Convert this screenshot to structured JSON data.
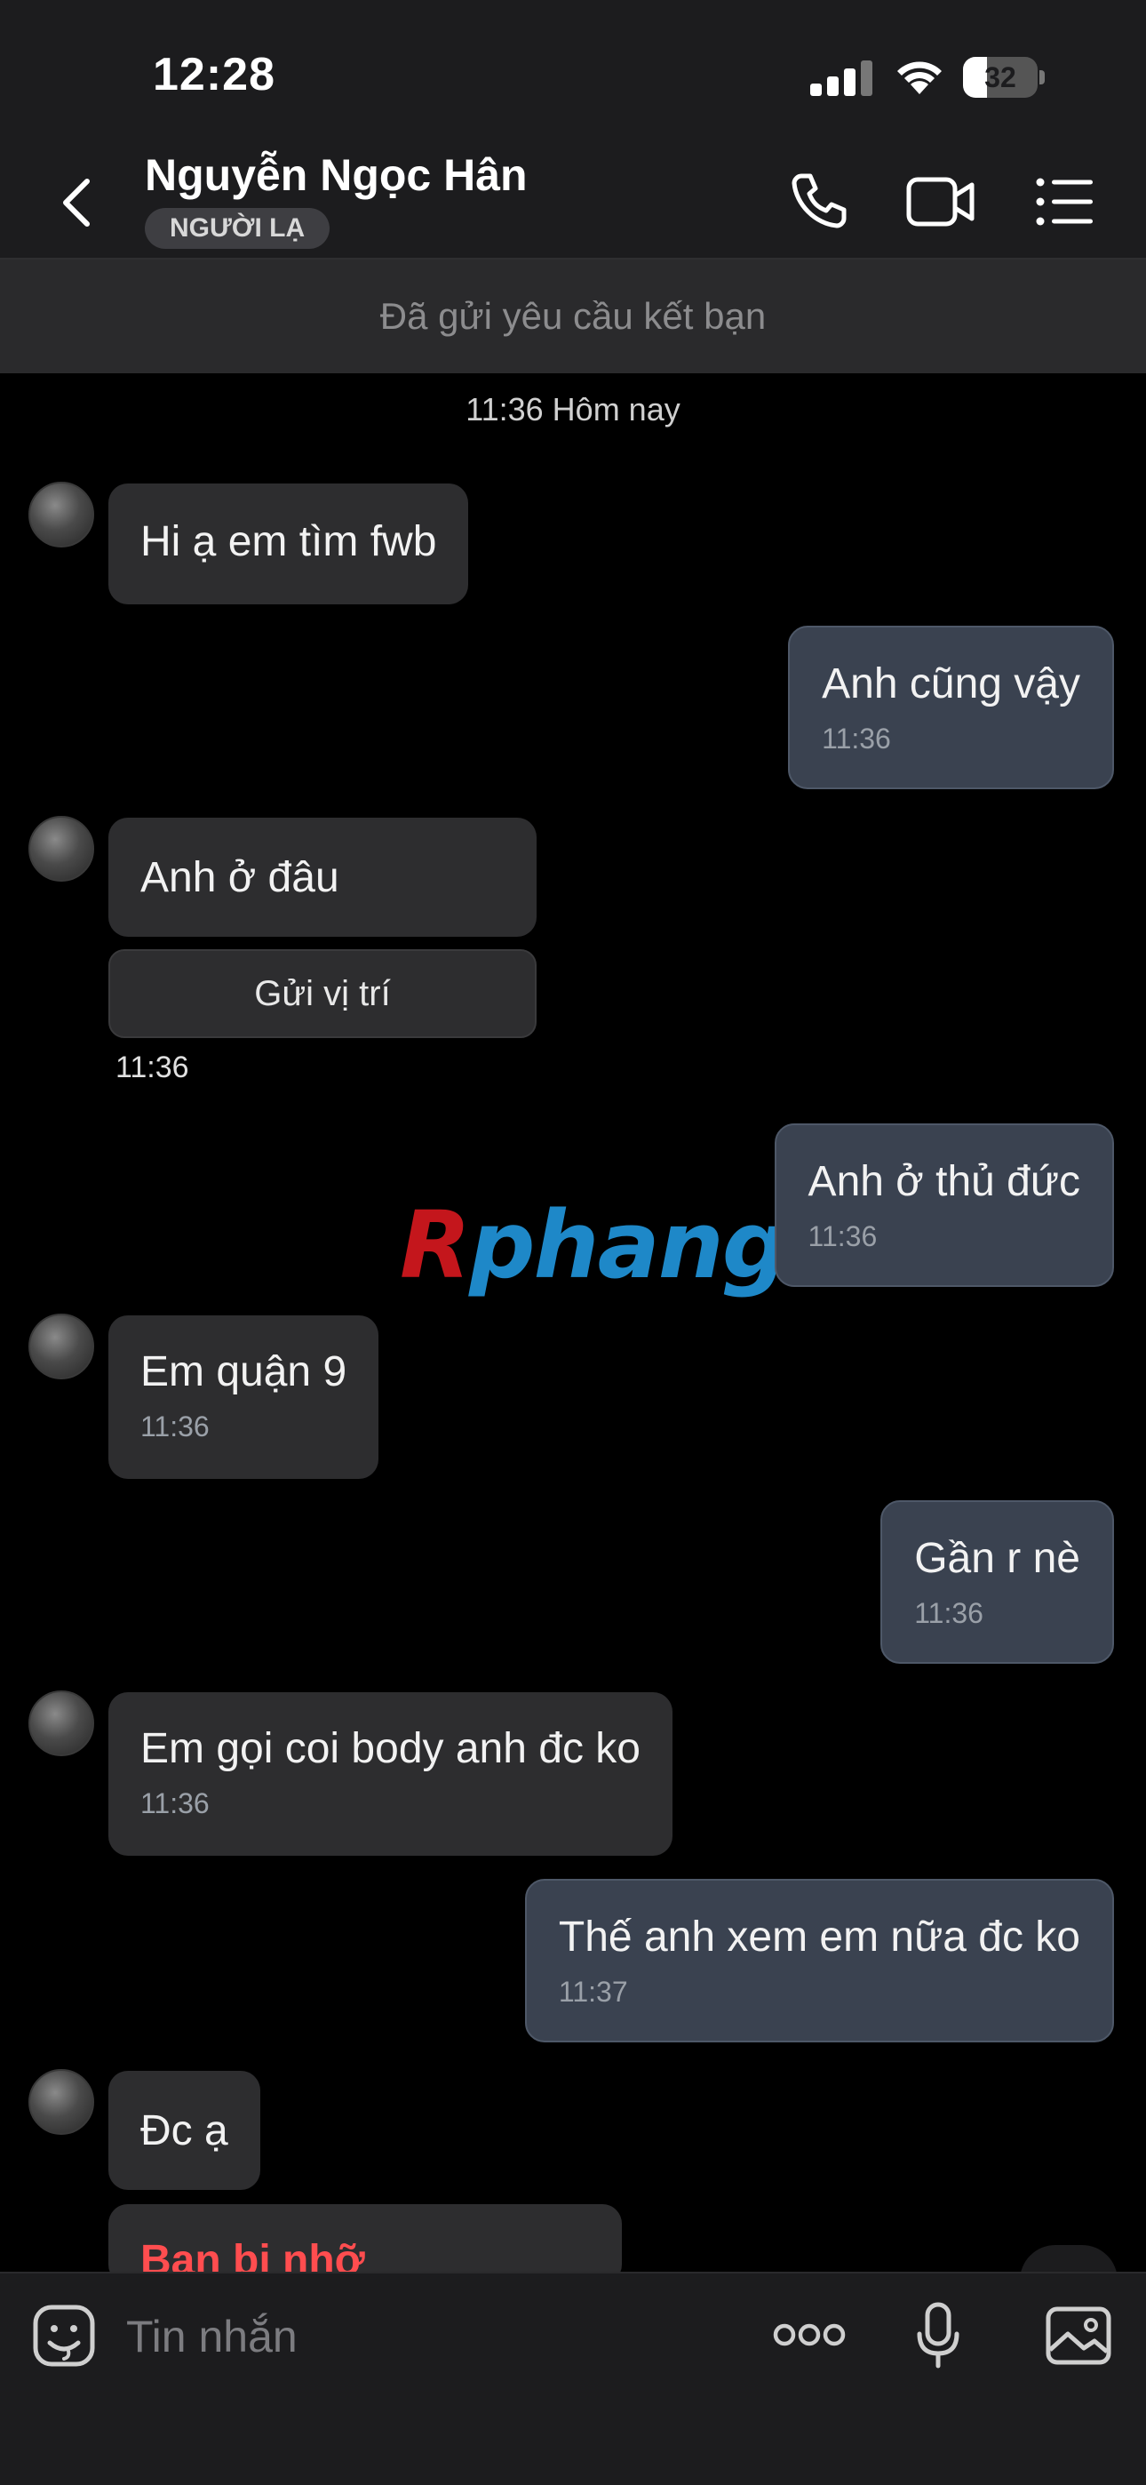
{
  "status_bar": {
    "time": "12:28",
    "battery": "32",
    "battery_level": 0.32
  },
  "header": {
    "contact_name": "Nguyễn Ngọc Hân",
    "badge": "NGƯỜI LẠ",
    "icons": [
      "back-chevron-icon",
      "phone-icon",
      "video-call-icon",
      "menu-list-icon"
    ]
  },
  "friend_request_banner": "Đã gửi yêu cầu kết bạn",
  "date_separator": "11:36 Hôm nay",
  "messages": [
    {
      "dir": "in",
      "text": "Hi ạ em tìm fwb"
    },
    {
      "dir": "out",
      "text": "Anh cũng vậy",
      "time": "11:36"
    },
    {
      "dir": "in",
      "text": "Anh ở đâu",
      "action": "Gửi vị trí",
      "time": "11:36"
    },
    {
      "dir": "out",
      "text": "Anh ở thủ đức",
      "time": "11:36"
    },
    {
      "dir": "in",
      "text": "Em quận 9",
      "time": "11:36"
    },
    {
      "dir": "out",
      "text": "Gần r nè",
      "time": "11:36"
    },
    {
      "dir": "in",
      "text": "Em gọi coi body anh đc ko",
      "time": "11:36"
    },
    {
      "dir": "out",
      "text": "Thế anh xem em nữa đc ko",
      "time": "11:37"
    },
    {
      "dir": "in",
      "text": "Đc ạ"
    },
    {
      "dir": "in",
      "text": "Bạn bị nhỡ"
    }
  ],
  "watermark": {
    "first": "R",
    "rest": "phang"
  },
  "composer": {
    "placeholder": "Tin nhắn",
    "icons": [
      "sticker-icon",
      "more-icon",
      "microphone-icon",
      "image-icon"
    ]
  },
  "colors": {
    "header_bg": "#1c1c1e",
    "incoming_bubble": "#2d2d2f",
    "outgoing_bubble": "#3a4250",
    "missed_call": "#ff4d4f"
  }
}
